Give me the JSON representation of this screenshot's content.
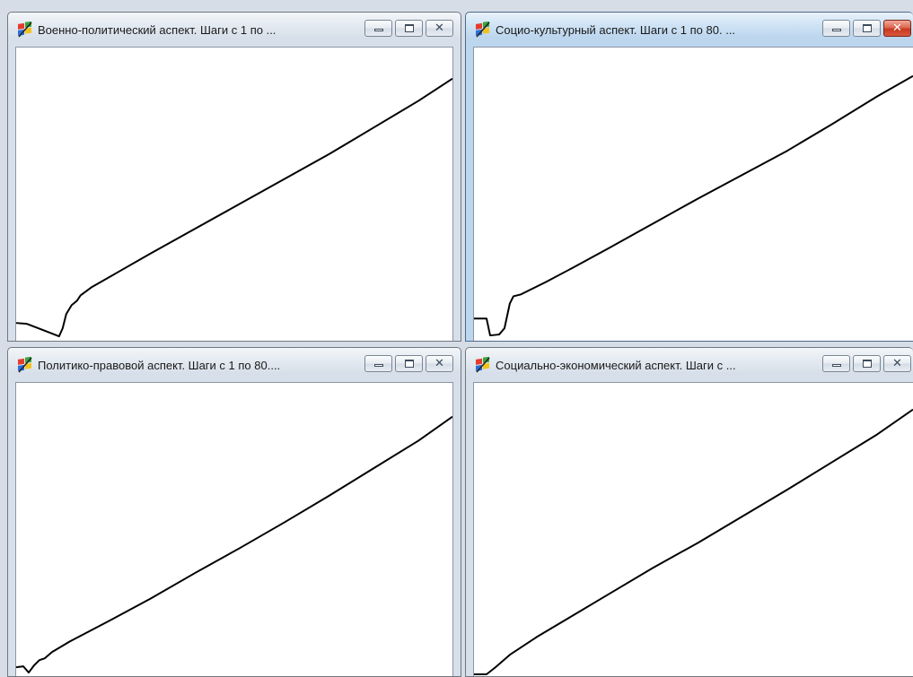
{
  "windows": [
    {
      "id": "military-political",
      "title": "Военно-политический аспект. Шаги с 1 по ...",
      "active": false,
      "buttons": [
        "minimize",
        "maximize",
        "close"
      ],
      "icon": "windows-app-icon",
      "plot_line": "descending-then-rising-diagonal"
    },
    {
      "id": "socio-cultural",
      "title": "Социо-культурный аспект. Шаги с 1 по 80. ...",
      "active": true,
      "buttons": [
        "minimize",
        "maximize",
        "close"
      ],
      "icon": "windows-app-icon",
      "plot_line": "dip-then-rising-diagonal"
    },
    {
      "id": "political-legal",
      "title": "Политико-правовой аспект. Шаги с 1 по 80....",
      "active": false,
      "buttons": [
        "minimize",
        "maximize",
        "close"
      ],
      "icon": "windows-app-icon",
      "plot_line": "dip-then-rising-diagonal"
    },
    {
      "id": "socio-economic",
      "title": "Социально-экономический аспект. Шаги с ...",
      "active": false,
      "buttons": [
        "minimize",
        "maximize",
        "close"
      ],
      "icon": "windows-app-icon",
      "plot_line": "flat-then-rising-diagonal"
    }
  ],
  "colors": {
    "plot_line": "#000000",
    "plot_background": "#ffffff",
    "close_active": "#c63a22"
  }
}
